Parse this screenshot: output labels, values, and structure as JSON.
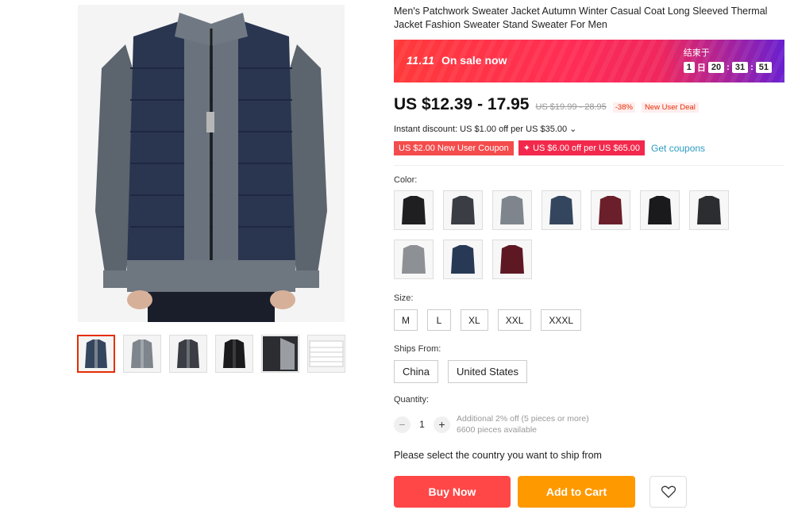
{
  "product": {
    "title": "Men's Patchwork Sweater Jacket Autumn Winter Casual Coat Long Sleeved Thermal Jacket Fashion Sweater Stand Sweater For Men"
  },
  "banner": {
    "logo": "11.11",
    "text": "On sale now",
    "countdown_label": "结束于",
    "days": "1",
    "day_unit": "日",
    "hours": "20",
    "minutes": "31",
    "seconds": "51"
  },
  "price": {
    "current": "US $12.39 - 17.95",
    "original": "US $19.99 - 28.95",
    "discount": "-38%",
    "deal_badge": "New User Deal"
  },
  "discount_line": "Instant discount: US $1.00 off per US $35.00 ⌄",
  "coupons": {
    "new_user": "US $2.00 New User Coupon",
    "store": "✦ US $6.00 off per US $65.00",
    "get": "Get coupons"
  },
  "color": {
    "label": "Color:",
    "swatches": [
      "#1f1f22",
      "#3b3d44",
      "#7e858c",
      "#34465e",
      "#6b1f2a",
      "#1a1a1c",
      "#2b2d30",
      "#8d9094",
      "#283955",
      "#5e1824"
    ]
  },
  "size": {
    "label": "Size:",
    "options": [
      "M",
      "L",
      "XL",
      "XXL",
      "XXXL"
    ]
  },
  "ships_from": {
    "label": "Ships From:",
    "options": [
      "China",
      "United States"
    ]
  },
  "quantity": {
    "label": "Quantity:",
    "value": "1",
    "minus": "−",
    "plus": "+",
    "note1": "Additional 2% off (5 pieces or more)",
    "note2": "6600 pieces available"
  },
  "ship_notice": "Please select the country you want to ship from",
  "actions": {
    "buy": "Buy Now",
    "cart": "Add to Cart"
  },
  "gallery": {
    "thumb_colors": [
      "#34465e",
      "#7e858c",
      "#3b3d44",
      "#1a1a1c",
      "#2b2d30",
      "#eeeeee"
    ]
  }
}
